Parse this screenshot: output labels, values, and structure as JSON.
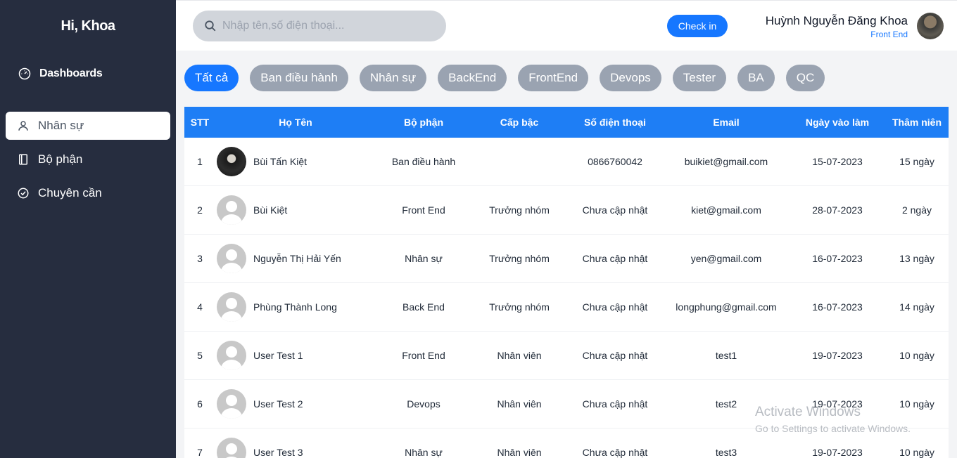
{
  "sidebar": {
    "greeting": "Hi, Khoa",
    "dashboard_label": "Dashboards",
    "items": [
      {
        "label": "Nhân sự",
        "icon": "user-icon",
        "active": true
      },
      {
        "label": "Bộ phận",
        "icon": "book-icon",
        "active": false
      },
      {
        "label": "Chuyên cần",
        "icon": "check-circle-icon",
        "active": false
      }
    ]
  },
  "header": {
    "search_placeholder": "Nhập tên,số điện thoại...",
    "checkin_label": "Check in",
    "user_name": "Huỳnh Nguyễn Đăng Khoa",
    "user_role": "Front End"
  },
  "filters": [
    "Tất cả",
    "Ban điều hành",
    "Nhân sự",
    "BackEnd",
    "FrontEnd",
    "Devops",
    "Tester",
    "BA",
    "QC"
  ],
  "table": {
    "columns": [
      "STT",
      "Họ Tên",
      "Bộ phận",
      "Cấp bậc",
      "Số điện thoại",
      "Email",
      "Ngày vào làm",
      "Thâm niên"
    ],
    "rows": [
      {
        "stt": "1",
        "name": "Bùi Tấn Kiệt",
        "dept": "Ban điều hành",
        "rank": "",
        "phone": "0866760042",
        "email": "buikiet@gmail.com",
        "date": "15-07-2023",
        "seniority": "15 ngày"
      },
      {
        "stt": "2",
        "name": "Bùi Kiệt",
        "dept": "Front End",
        "rank": "Trưởng nhóm",
        "phone": "Chưa cập nhật",
        "email": "kiet@gmail.com",
        "date": "28-07-2023",
        "seniority": "2 ngày"
      },
      {
        "stt": "3",
        "name": "Nguyễn Thị Hải Yến",
        "dept": "Nhân sự",
        "rank": "Trưởng nhóm",
        "phone": "Chưa cập nhật",
        "email": "yen@gmail.com",
        "date": "16-07-2023",
        "seniority": "13 ngày"
      },
      {
        "stt": "4",
        "name": "Phùng Thành Long",
        "dept": "Back End",
        "rank": "Trưởng nhóm",
        "phone": "Chưa cập nhật",
        "email": "longphung@gmail.com",
        "date": "16-07-2023",
        "seniority": "14 ngày"
      },
      {
        "stt": "5",
        "name": "User Test 1",
        "dept": "Front End",
        "rank": "Nhân viên",
        "phone": "Chưa cập nhật",
        "email": "test1",
        "date": "19-07-2023",
        "seniority": "10 ngày"
      },
      {
        "stt": "6",
        "name": "User Test 2",
        "dept": "Devops",
        "rank": "Nhân viên",
        "phone": "Chưa cập nhật",
        "email": "test2",
        "date": "19-07-2023",
        "seniority": "10 ngày"
      },
      {
        "stt": "7",
        "name": "User Test 3",
        "dept": "Nhân sự",
        "rank": "Nhân viên",
        "phone": "Chưa cập nhật",
        "email": "test3",
        "date": "19-07-2023",
        "seniority": "10 ngày"
      }
    ]
  },
  "watermark": {
    "line1": "Activate Windows",
    "line2": "Go to Settings to activate Windows."
  }
}
